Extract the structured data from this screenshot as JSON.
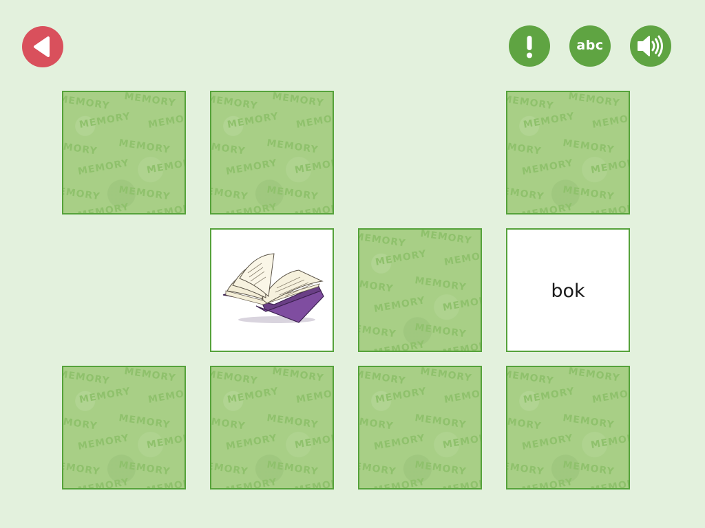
{
  "toolbar": {
    "back_icon": "back-arrow-icon",
    "hint_icon": "exclamation-icon",
    "abc_label": "abc",
    "sound_icon": "speaker-icon"
  },
  "colors": {
    "background": "#e3f1dd",
    "back_button": "#d9505c",
    "action_buttons": "#5fa442",
    "card_back": "#a8cf86",
    "card_border": "#55a23a",
    "card_pattern_text": "#8fc16c"
  },
  "card_back_text": "MEMORY",
  "cards": [
    {
      "state": "hidden"
    },
    {
      "state": "hidden"
    },
    {
      "state": "matched"
    },
    {
      "state": "hidden"
    },
    {
      "state": "matched"
    },
    {
      "state": "revealed",
      "content_type": "image",
      "image": "open-book-image"
    },
    {
      "state": "hidden"
    },
    {
      "state": "revealed",
      "content_type": "word",
      "word": "bok"
    },
    {
      "state": "hidden"
    },
    {
      "state": "hidden"
    },
    {
      "state": "hidden"
    },
    {
      "state": "hidden"
    }
  ]
}
